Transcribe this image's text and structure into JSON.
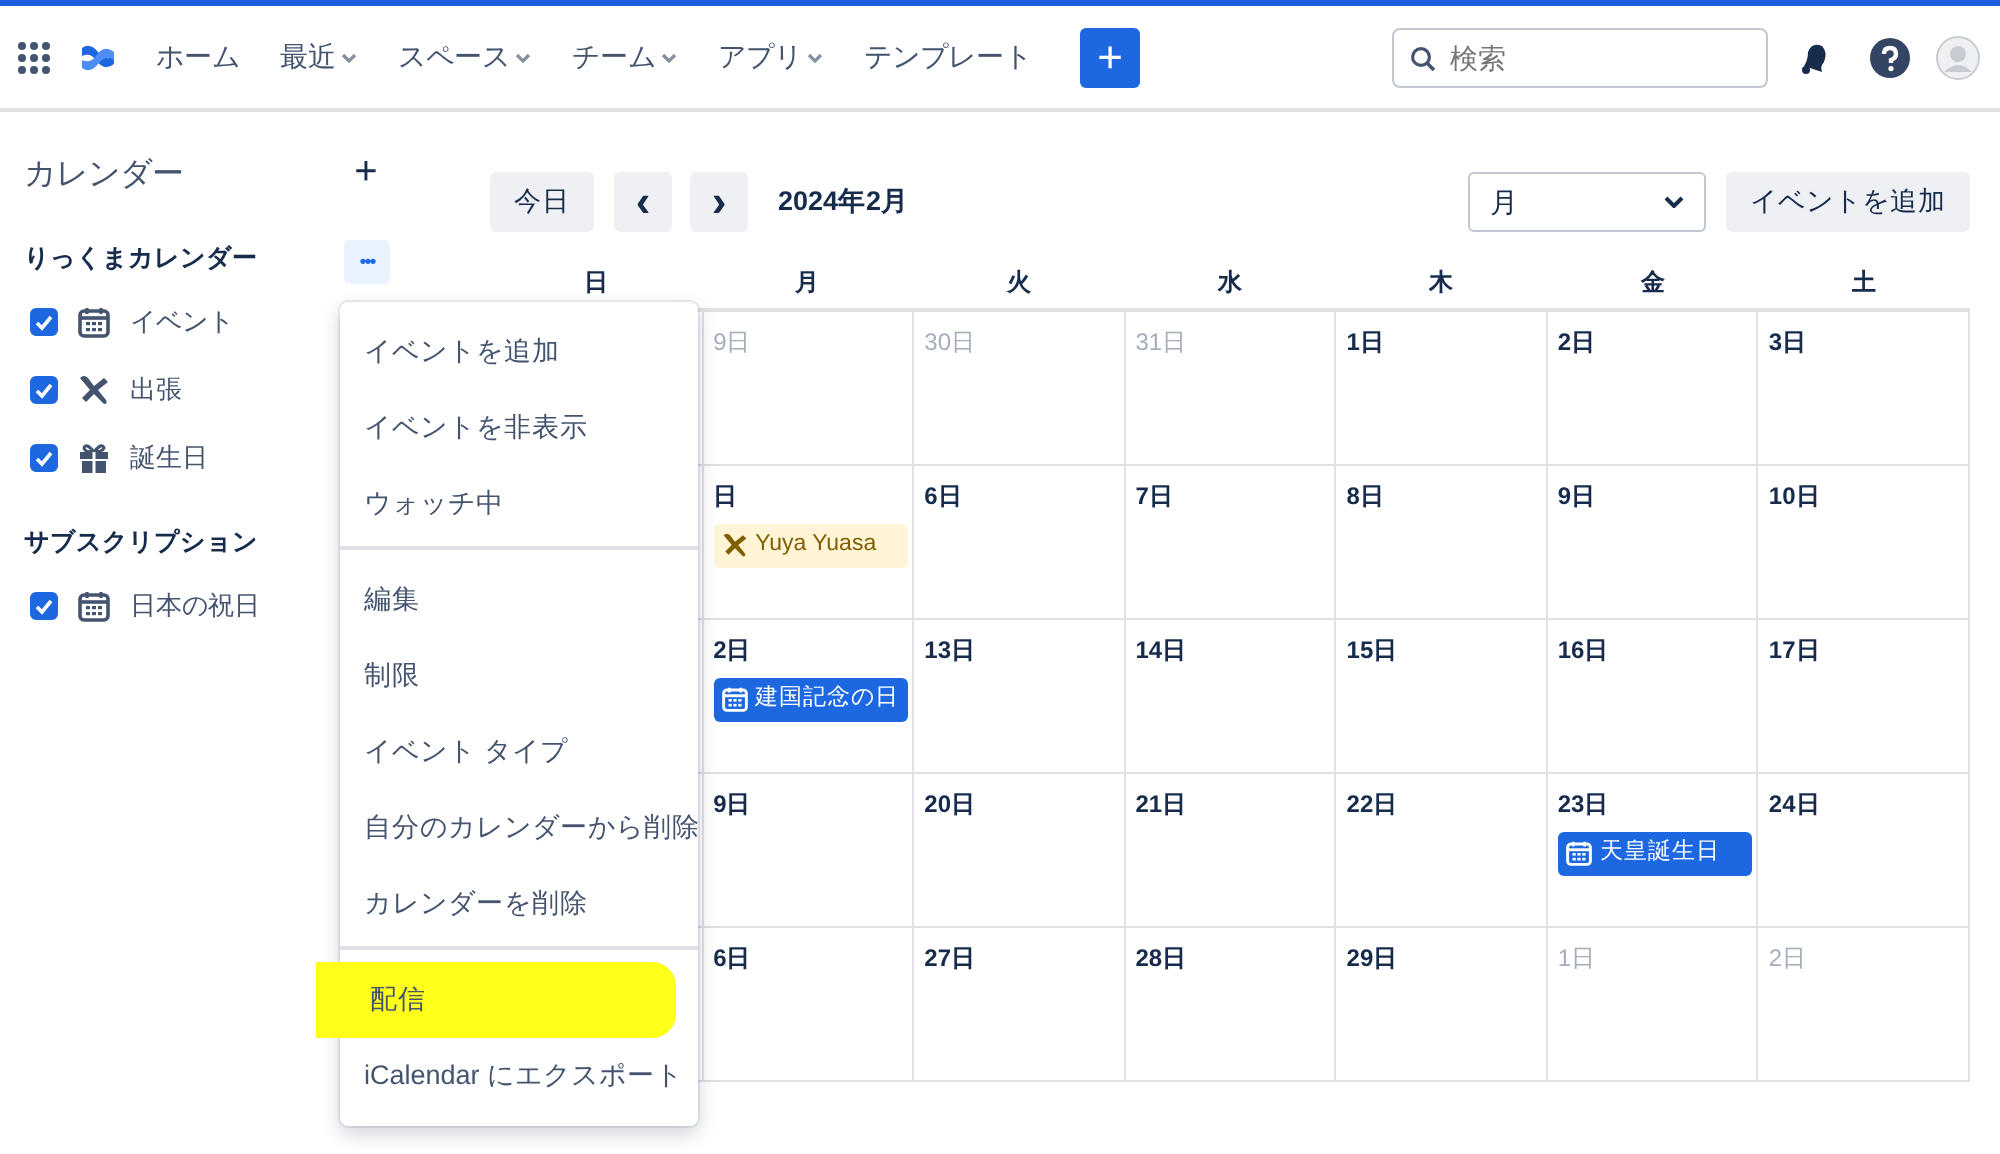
{
  "nav": {
    "items": [
      {
        "label": "ホーム",
        "dropdown": false
      },
      {
        "label": "最近",
        "dropdown": true
      },
      {
        "label": "スペース",
        "dropdown": true
      },
      {
        "label": "チーム",
        "dropdown": true
      },
      {
        "label": "アプリ",
        "dropdown": true
      },
      {
        "label": "テンプレート",
        "dropdown": false
      }
    ],
    "create_label": "+",
    "search": {
      "placeholder": "検索"
    }
  },
  "sidebar": {
    "title": "カレンダー",
    "add_label": "+",
    "more_label": "•••",
    "sections": [
      {
        "title": "りっくまカレンダー",
        "items": [
          {
            "label": "イベント",
            "kind": "calendar",
            "checked": true
          },
          {
            "label": "出張",
            "kind": "plane",
            "checked": true
          },
          {
            "label": "誕生日",
            "kind": "gift",
            "checked": true
          }
        ]
      },
      {
        "title": "サブスクリプション",
        "items": [
          {
            "label": "日本の祝日",
            "kind": "calendar",
            "checked": true
          }
        ]
      }
    ]
  },
  "toolbar": {
    "today": "今日",
    "prev": "‹",
    "next": "›",
    "title": "2024年2月",
    "view": "月",
    "add_event": "イベントを追加"
  },
  "weekdays": [
    "日",
    "月",
    "火",
    "水",
    "木",
    "金",
    "土"
  ],
  "weeks": [
    {
      "cells": [
        {
          "date": "9日",
          "muted": true
        },
        {
          "date": "30日",
          "muted": true
        },
        {
          "date": "31日",
          "muted": true
        },
        {
          "date": "1日",
          "muted": false
        },
        {
          "date": "2日",
          "muted": false
        },
        {
          "date": "3日",
          "muted": false
        }
      ]
    },
    {
      "cells": [
        {
          "date": "日",
          "muted": false,
          "events": [
            {
              "label": "Yuya Yuasa",
              "kind": "travel"
            }
          ]
        },
        {
          "date": "6日",
          "muted": false
        },
        {
          "date": "7日",
          "muted": false
        },
        {
          "date": "8日",
          "muted": false
        },
        {
          "date": "9日",
          "muted": false
        },
        {
          "date": "10日",
          "muted": false
        }
      ]
    },
    {
      "cells": [
        {
          "date": "2日",
          "muted": false,
          "events": [
            {
              "label": "建国記念の日",
              "kind": "holiday"
            }
          ]
        },
        {
          "date": "13日",
          "muted": false
        },
        {
          "date": "14日",
          "muted": false
        },
        {
          "date": "15日",
          "muted": false
        },
        {
          "date": "16日",
          "muted": false
        },
        {
          "date": "17日",
          "muted": false
        }
      ]
    },
    {
      "cells": [
        {
          "date": "9日",
          "muted": false
        },
        {
          "date": "20日",
          "muted": false
        },
        {
          "date": "21日",
          "muted": false
        },
        {
          "date": "22日",
          "muted": false
        },
        {
          "date": "23日",
          "muted": false,
          "events": [
            {
              "label": "天皇誕生日",
              "kind": "holiday"
            }
          ]
        },
        {
          "date": "24日",
          "muted": false
        }
      ]
    },
    {
      "cells": [
        {
          "date": "6日",
          "muted": false
        },
        {
          "date": "27日",
          "muted": false
        },
        {
          "date": "28日",
          "muted": false
        },
        {
          "date": "29日",
          "muted": false
        },
        {
          "date": "1日",
          "muted": true
        },
        {
          "date": "2日",
          "muted": true
        }
      ]
    }
  ],
  "menu": {
    "groups": [
      [
        {
          "label": "イベントを追加",
          "highlighted": false
        },
        {
          "label": "イベントを非表示",
          "highlighted": false
        },
        {
          "label": "ウォッチ中",
          "highlighted": false
        }
      ],
      [
        {
          "label": "編集",
          "highlighted": false
        },
        {
          "label": "制限",
          "highlighted": false
        },
        {
          "label": "イベント タイプ",
          "highlighted": false
        },
        {
          "label": "自分のカレンダーから削除",
          "highlighted": false
        },
        {
          "label": "カレンダーを削除",
          "highlighted": false
        }
      ],
      [
        {
          "label": "配信",
          "highlighted": true
        },
        {
          "label": "iCalendar にエクスポート",
          "highlighted": false
        }
      ]
    ]
  }
}
